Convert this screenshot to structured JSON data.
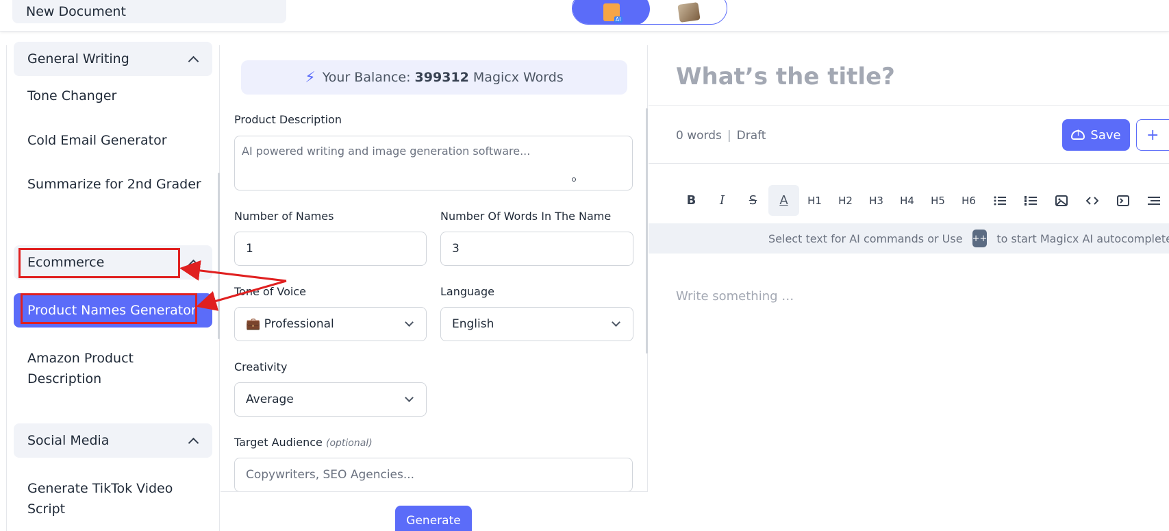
{
  "topbar": {
    "new_document": "New Document",
    "mode_toggle": [
      "ai-writer-icon",
      "ai-image-icon"
    ]
  },
  "sidebar": {
    "categories": [
      {
        "label": "General Writing",
        "items": [
          "Tone Changer",
          "Cold Email Generator",
          "Summarize for 2nd Grader"
        ]
      },
      {
        "label": "Ecommerce",
        "items": [
          "Product Names Generator",
          "Amazon Product Description"
        ]
      },
      {
        "label": "Social Media",
        "items": [
          "Generate TikTok Video Script"
        ]
      }
    ],
    "active_item": "Product Names Generator"
  },
  "form": {
    "balance_prefix": "Your Balance:",
    "balance_value": "399312",
    "balance_suffix": "Magicx Words",
    "product_description_label": "Product Description",
    "product_description_placeholder": "AI powered writing and image generation software...",
    "number_of_names_label": "Number of Names",
    "number_of_names_value": "1",
    "words_in_name_label": "Number Of Words In The Name",
    "words_in_name_value": "3",
    "tone_label": "Tone of Voice",
    "tone_value": "💼 Professional",
    "language_label": "Language",
    "language_value": "English",
    "creativity_label": "Creativity",
    "creativity_value": "Average",
    "audience_label": "Target Audience",
    "audience_optional": "(optional)",
    "audience_placeholder": "Copywriters, SEO Agencies...",
    "generate_label": "Generate"
  },
  "editor": {
    "title_placeholder": "What’s the title?",
    "word_count": "0 words",
    "separator": "|",
    "status": "Draft",
    "save_label": "Save",
    "add_label": "+",
    "toolbar": [
      "B",
      "I",
      "S",
      "A",
      "H1",
      "H2",
      "H3",
      "H4",
      "H5",
      "H6"
    ],
    "hint_prefix": "Select text for AI commands or Use",
    "hint_key": "++",
    "hint_suffix": "to start Magicx AI autocomplete",
    "body_placeholder": "Write something …"
  },
  "colors": {
    "accent": "#5b6cf9",
    "annotation": "#e02020"
  }
}
